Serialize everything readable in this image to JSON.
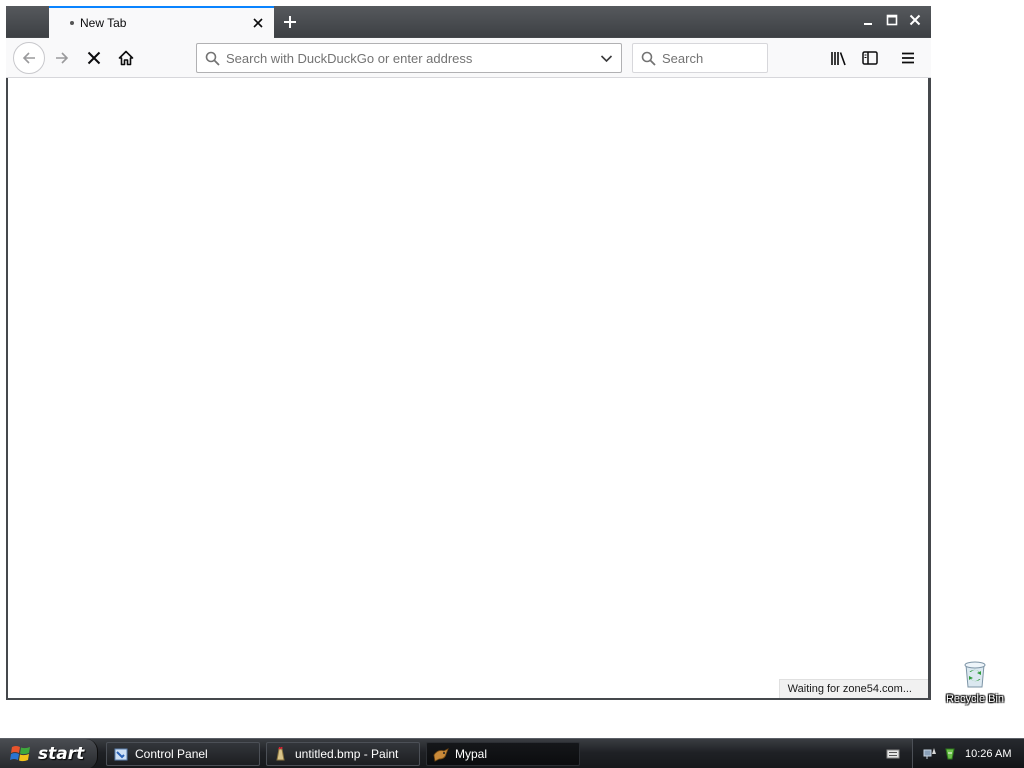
{
  "browser": {
    "tab": {
      "title": "New Tab"
    },
    "urlbar": {
      "placeholder": "Search with DuckDuckGo or enter address",
      "value": ""
    },
    "searchbar": {
      "placeholder": "Search"
    },
    "status": "Waiting for zone54.com...",
    "accent_color": "#0a84ff"
  },
  "desktop": {
    "icons": [
      {
        "label": "Recycle Bin"
      }
    ]
  },
  "taskbar": {
    "start_label": "start",
    "tasks": [
      {
        "label": "Control Panel",
        "icon": "control-panel-icon",
        "active": false
      },
      {
        "label": "untitled.bmp - Paint",
        "icon": "paint-icon",
        "active": false
      },
      {
        "label": "Mypal",
        "icon": "mypal-icon",
        "active": true
      }
    ],
    "clock": "10:26 AM"
  }
}
